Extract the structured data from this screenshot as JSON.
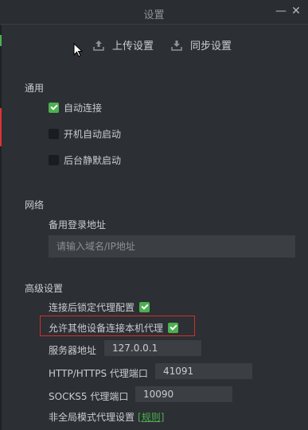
{
  "window": {
    "title": "设置",
    "minimize_label": "—",
    "close_label": "✕"
  },
  "toolbar": {
    "upload_label": "上传设置",
    "sync_label": "同步设置"
  },
  "general": {
    "title": "通用",
    "auto_connect": {
      "label": "自动连接",
      "checked": true
    },
    "start_on_boot": {
      "label": "开机自动启动",
      "checked": false
    },
    "silent_start": {
      "label": "后台静默启动",
      "checked": false
    }
  },
  "network": {
    "title": "网络",
    "backup_login_label": "备用登录地址",
    "backup_login_placeholder": "请输入域名/IP地址",
    "backup_login_value": ""
  },
  "advanced": {
    "title": "高级设置",
    "lock_proxy": {
      "label": "连接后锁定代理配置",
      "checked": true
    },
    "allow_other_devices": {
      "label": "允许其他设备连接本机代理",
      "checked": true
    },
    "server_address_label": "服务器地址",
    "server_address_value": "127.0.0.1",
    "http_port_label": "HTTP/HTTPS 代理端口",
    "http_port_value": "41091",
    "socks5_port_label": "SOCKS5 代理端口",
    "socks5_port_value": "10090",
    "non_global_label": "非全局模式代理设置",
    "rules_link": "[规则]"
  },
  "colors": {
    "background": "#2c2f33",
    "accent": "#4cb050",
    "highlight": "#d32f2f",
    "input_bg": "#3b3e43"
  }
}
